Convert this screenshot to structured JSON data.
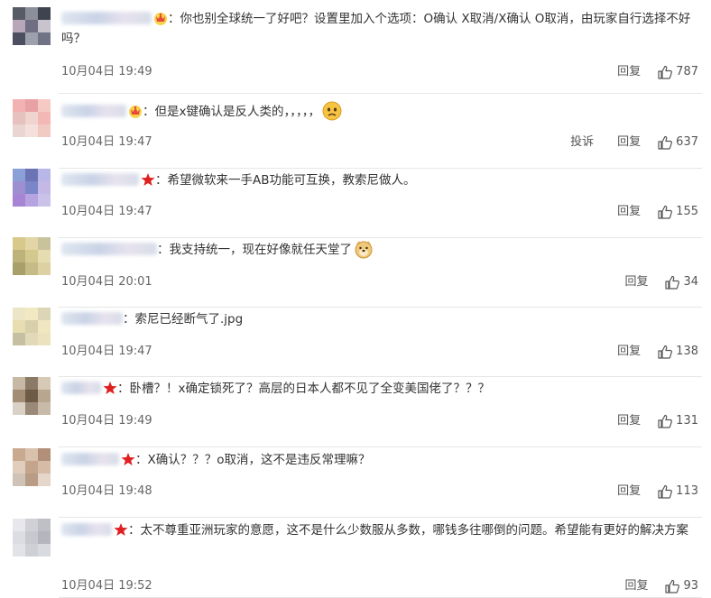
{
  "comments": [
    {
      "badge": "crown",
      "text": "你也别全球统一了好吧？设置里加入个选项：O确认 X取消/X确认 O取消，由玩家自行选择不好吗？",
      "emoji": "",
      "time": "10月04日 19:49",
      "report": "",
      "reply": "回复",
      "likes": "787",
      "avatar": [
        "#575b66",
        "#8c8f9a",
        "#3f4350",
        "#b8a7b8",
        "#6f6e82",
        "#c8c3cd",
        "#4c4f5f",
        "#9fa0ae",
        "#707385"
      ]
    },
    {
      "badge": "crown",
      "text": "但是x键确认是反人类的，，，，，",
      "emoji": "worried-face",
      "time": "10月04日 19:47",
      "report": "投诉",
      "reply": "回复",
      "likes": "637",
      "avatar": [
        "#f2b2b2",
        "#e8a1a4",
        "#f6c9c4",
        "#e6c1bd",
        "#f0d4d0",
        "#f3b7b5",
        "#e9d6d3",
        "#f5e0dc",
        "#f1cac4"
      ]
    },
    {
      "badge": "star",
      "text": "希望微软来一手AB功能可互换，教索尼做人。",
      "emoji": "",
      "time": "10月04日 19:47",
      "report": "",
      "reply": "回复",
      "likes": "155",
      "avatar": [
        "#8aa0d6",
        "#6d74b6",
        "#b9b7e8",
        "#9d8fd0",
        "#7a86c8",
        "#c5b8e6",
        "#a884d4",
        "#b6a3e0",
        "#cbc2ea"
      ]
    },
    {
      "badge": "",
      "text": "我支持统一，现在好像就任天堂了",
      "emoji": "doge",
      "time": "10月04日 20:01",
      "report": "",
      "reply": "回复",
      "likes": "34",
      "avatar": [
        "#d8c88a",
        "#e2d5a6",
        "#c9c39b",
        "#bdb27a",
        "#d3c98f",
        "#e6dcb2",
        "#a7a06a",
        "#c5bb86",
        "#ddd1a3"
      ]
    },
    {
      "badge": "",
      "text": "索尼已经断气了.jpg",
      "emoji": "",
      "time": "10月04日 19:47",
      "report": "",
      "reply": "回复",
      "likes": "138",
      "avatar": [
        "#ece6c6",
        "#f2e9c2",
        "#ddd6b6",
        "#e8ddb0",
        "#d8d0ab",
        "#f0e6c0",
        "#c6bfa2",
        "#e2d9b8",
        "#ece2bd"
      ]
    },
    {
      "badge": "star",
      "text": "卧槽？！x确定锁死了？高层的日本人都不见了全变美国佬了？？？",
      "emoji": "",
      "time": "10月04日 19:49",
      "report": "",
      "reply": "回复",
      "likes": "131",
      "avatar": [
        "#c8b8a6",
        "#8b7a66",
        "#d6c9b6",
        "#a38d74",
        "#6e5b47",
        "#b9a68f",
        "#d9d0c6",
        "#9a8978",
        "#c7baa8"
      ]
    },
    {
      "badge": "star",
      "text": "X确认？？？o取消，这不是违反常理嘛？",
      "emoji": "",
      "time": "10月04日 19:48",
      "report": "",
      "reply": "回复",
      "likes": "113",
      "avatar": [
        "#c9a98f",
        "#d8c1ad",
        "#b18f78",
        "#e0cdbd",
        "#c4a58c",
        "#d6bca6",
        "#cfc2b6",
        "#b89c85",
        "#e4d6c8"
      ]
    },
    {
      "badge": "star",
      "text": "太不尊重亚洲玩家的意愿，这不是什么少数服从多数，哪钱多往哪倒的问题。希望能有更好的解决方案",
      "emoji": "",
      "time": "10月04日 19:52",
      "report": "",
      "reply": "回复",
      "likes": "93",
      "avatar": [
        "#e8e8ec",
        "#d0d1d6",
        "#bfc0c6",
        "#dcdde2",
        "#c8c9cf",
        "#b5b6bd",
        "#e2e3e7",
        "#cfd0d6",
        "#d9dadf"
      ]
    }
  ],
  "colors": {
    "text": "#333333",
    "meta": "#666666",
    "star": "#e02020",
    "crown": "#f5a623",
    "divider": "#e6e6e6"
  }
}
